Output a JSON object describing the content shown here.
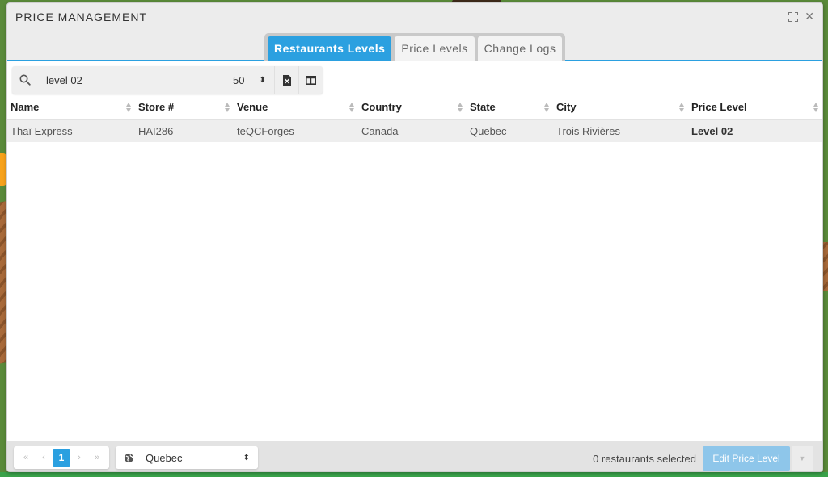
{
  "window": {
    "title": "PRICE MANAGEMENT"
  },
  "tabs": [
    {
      "label": "Restaurants Levels",
      "active": true
    },
    {
      "label": "Price Levels",
      "active": false
    },
    {
      "label": "Change Logs",
      "active": false
    }
  ],
  "toolbar": {
    "search_value": "level 02",
    "page_size": "50",
    "page_size_arrow": "⬍"
  },
  "table": {
    "headers": [
      "Name",
      "Store #",
      "Venue",
      "Country",
      "State",
      "City",
      "Price Level"
    ],
    "rows": [
      {
        "name": "Thaï Express",
        "store": "HAI286",
        "venue": "teQCForges",
        "country": "Canada",
        "state": "Quebec",
        "city": "Trois Rivières",
        "price_level": "Level 02"
      }
    ]
  },
  "footer": {
    "pager": {
      "first": "«",
      "prev": "‹",
      "current": "1",
      "next": "›",
      "last": "»"
    },
    "region": "Quebec",
    "region_arrow": "⬍",
    "selected_count": "0 restaurants selected",
    "edit_button": "Edit Price Level",
    "edit_caret": "▼"
  },
  "colors": {
    "accent": "#2ba0e0",
    "edit_button_disabled": "#8ec6ea"
  },
  "icons": [
    "expand-icon",
    "close-icon",
    "search-icon",
    "export-excel-icon",
    "columns-icon",
    "globe-icon",
    "sort-icon"
  ]
}
